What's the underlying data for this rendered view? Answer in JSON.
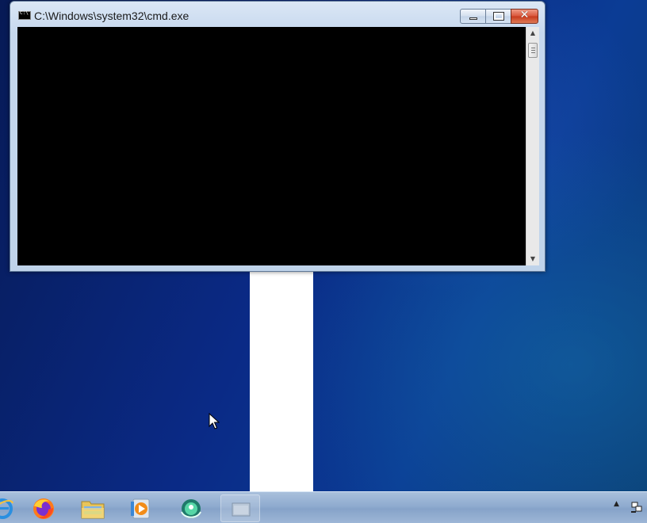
{
  "window": {
    "title": "C:\\Windows\\system32\\cmd.exe",
    "icon": "cmd-icon",
    "console_text": "",
    "buttons": {
      "minimize": "minimize-icon",
      "maximize": "maximize-icon",
      "close": "✕"
    },
    "scrollbar": {
      "up": "▲",
      "down": "▼"
    }
  },
  "taskbar": {
    "items": [
      {
        "name": "internet-explorer",
        "icon": "ie-icon"
      },
      {
        "name": "firefox",
        "icon": "firefox-icon"
      },
      {
        "name": "file-explorer",
        "icon": "folder-icon"
      },
      {
        "name": "media-player",
        "icon": "media-player-icon"
      },
      {
        "name": "app-green-circle",
        "icon": "green-circle-icon"
      },
      {
        "name": "cmd-window",
        "icon": "cmd-taskbar-icon"
      }
    ],
    "tray": {
      "arrow": "▲",
      "network": "network-icon"
    }
  },
  "colors": {
    "console_bg": "#000000",
    "desktop_bg": "#0a2a86",
    "taskbar": "#8fabcf",
    "close_button": "#c7391c"
  }
}
